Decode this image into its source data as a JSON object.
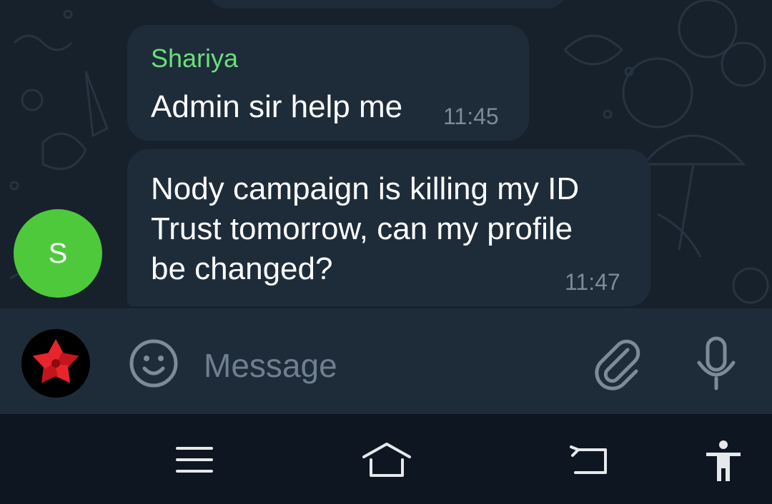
{
  "messages": [
    {
      "sender": "Shariya",
      "text": "Admin sir help me",
      "time": "11:45"
    },
    {
      "text_lines": [
        "Nody campaign is killing my ID",
        "Trust tomorrow, can my profile",
        "be changed?"
      ],
      "time": "11:47"
    }
  ],
  "sender_avatar": {
    "initial": "S",
    "color": "#4fc93c"
  },
  "composer": {
    "placeholder": "Message"
  },
  "icons": {
    "emoji": "smiley-face-icon",
    "attach": "paperclip-icon",
    "mic": "microphone-icon",
    "menu": "recent-apps-icon",
    "home": "home-icon",
    "back": "back-icon",
    "accessibility": "accessibility-icon"
  },
  "colors": {
    "chat_background": "#17212b",
    "bubble": "#1e2c3a",
    "sender_name": "#6bde7a",
    "timestamp": "#7d8b99",
    "nav_background": "#0e1621"
  }
}
